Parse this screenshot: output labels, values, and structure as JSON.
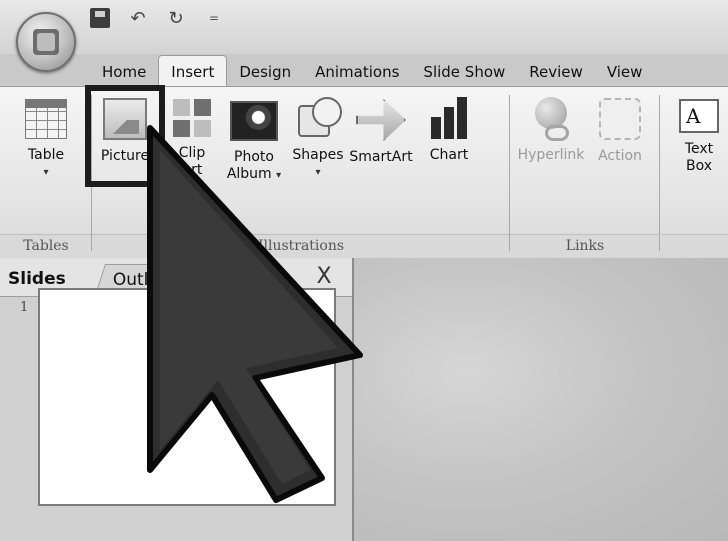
{
  "quick_access": {
    "items": [
      "save-icon",
      "undo-icon",
      "redo-icon",
      "customize-arrow-icon"
    ]
  },
  "tabs": [
    {
      "label": "Home"
    },
    {
      "label": "Insert"
    },
    {
      "label": "Design"
    },
    {
      "label": "Animations"
    },
    {
      "label": "Slide Show"
    },
    {
      "label": "Review"
    },
    {
      "label": "View"
    }
  ],
  "ribbon": {
    "tables": {
      "label": "Tables",
      "table_line1": "Table",
      "table_arrow": "▾"
    },
    "illustrations": {
      "label": "Illustrations",
      "picture": "Picture",
      "clip_line1": "Clip",
      "clip_line2": "Art",
      "photo_line1": "Photo",
      "photo_line2": "Album",
      "photo_arrow": "▾",
      "shapes": "Shapes",
      "shapes_arrow": "▾",
      "smartart": "SmartArt",
      "chart": "Chart"
    },
    "links": {
      "label": "Links",
      "hyperlink": "Hyperlink",
      "action": "Action"
    },
    "text": {
      "textbox_line1": "Text",
      "textbox_line2": "Box",
      "textbox_icon_text": "A"
    }
  },
  "pane": {
    "tab_slides": "Slides",
    "tab_outline": "Outl",
    "close": "X",
    "slide_number": "1"
  }
}
